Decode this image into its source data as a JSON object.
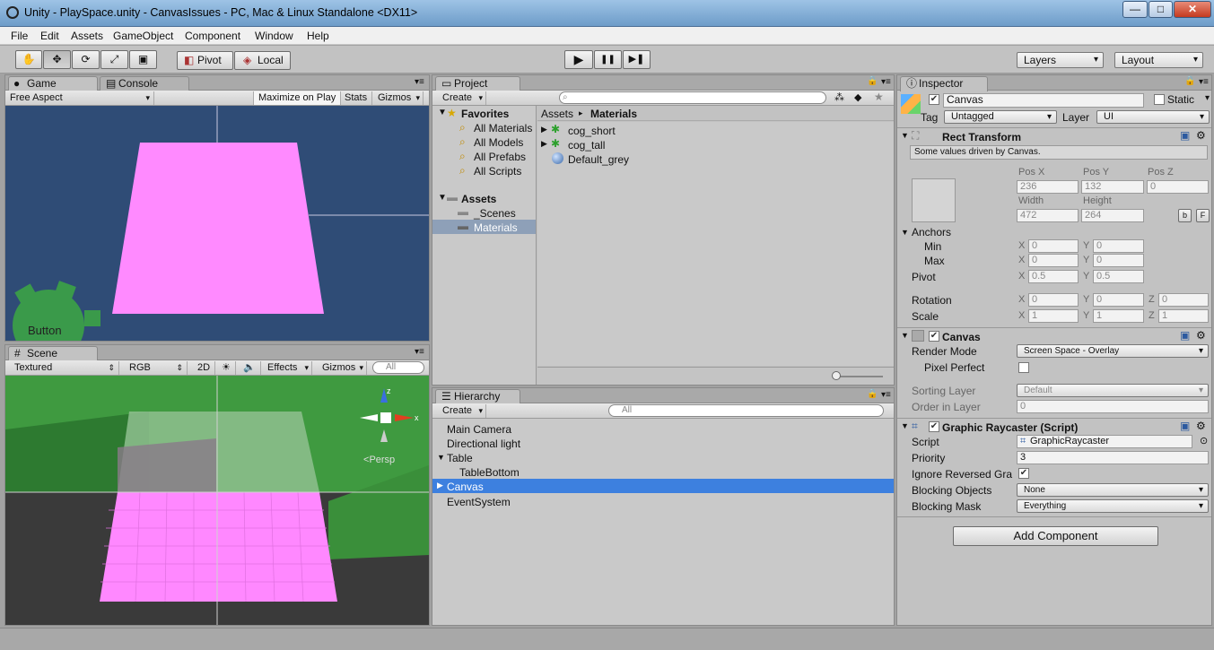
{
  "window": {
    "title": "Unity - PlaySpace.unity - CanvasIssues - PC, Mac & Linux Standalone <DX11>",
    "min": "—",
    "max": "□",
    "close": "✕"
  },
  "menu": [
    "File",
    "Edit",
    "Assets",
    "GameObject",
    "Component",
    "Window",
    "Help"
  ],
  "toolbar": {
    "pivot": "Pivot",
    "local": "Local",
    "play": "▶",
    "pause": "❚❚",
    "step": "▶❚",
    "layers": "Layers",
    "layout": "Layout"
  },
  "game": {
    "tab": "Game",
    "console_tab": "Console",
    "aspect": "Free Aspect",
    "maximize": "Maximize on Play",
    "stats": "Stats",
    "gizmos": "Gizmos",
    "button_label": "Button"
  },
  "scene": {
    "tab": "Scene",
    "shading": "Textured",
    "rgb": "RGB",
    "mode2d": "2D",
    "effects": "Effects",
    "gizmos": "Gizmos",
    "search": "All",
    "persp": "Persp",
    "axis_y": "z",
    "axis_x": "x"
  },
  "project": {
    "tab": "Project",
    "create": "Create",
    "favorites": "Favorites",
    "fav_items": [
      "All Materials",
      "All Models",
      "All Prefabs",
      "All Scripts"
    ],
    "assets": "Assets",
    "asset_items": [
      "_Scenes",
      "Materials"
    ],
    "crumb1": "Assets",
    "crumb_sep": "▸",
    "crumb2": "Materials",
    "files": [
      "cog_short",
      "cog_tall",
      "Default_grey"
    ]
  },
  "hierarchy": {
    "tab": "Hierarchy",
    "create": "Create",
    "search": "All",
    "items": [
      "Main Camera",
      "Directional light",
      "Table",
      "TableBottom",
      "Canvas",
      "EventSystem"
    ]
  },
  "inspector": {
    "tab": "Inspector",
    "name": "Canvas",
    "static": "Static",
    "tag_label": "Tag",
    "tag": "Untagged",
    "layer_label": "Layer",
    "layer": "UI",
    "rect": {
      "title": "Rect Transform",
      "note": "Some values driven by Canvas.",
      "posx_l": "Pos X",
      "posy_l": "Pos Y",
      "posz_l": "Pos Z",
      "posx": "236",
      "posy": "132",
      "posz": "0",
      "w_l": "Width",
      "h_l": "Height",
      "w": "472",
      "h": "264",
      "b": "b",
      "r": "F",
      "anchors": "Anchors",
      "min": "Min",
      "max": "Max",
      "pivot": "Pivot",
      "minx": "0",
      "miny": "0",
      "maxx": "0",
      "maxy": "0",
      "pivx": "0.5",
      "pivy": "0.5",
      "rotation": "Rotation",
      "rotx": "0",
      "roty": "0",
      "rotz": "0",
      "scale": "Scale",
      "sx": "1",
      "sy": "1",
      "sz": "1",
      "X": "X",
      "Y": "Y",
      "Z": "Z"
    },
    "canvas": {
      "title": "Canvas",
      "render_mode_l": "Render Mode",
      "render_mode": "Screen Space - Overlay",
      "pixel_perfect": "Pixel Perfect",
      "sorting_l": "Sorting Layer",
      "sorting": "Default",
      "order_l": "Order in Layer",
      "order": "0"
    },
    "raycaster": {
      "title": "Graphic Raycaster (Script)",
      "script_l": "Script",
      "script": "GraphicRaycaster",
      "priority_l": "Priority",
      "priority": "3",
      "ignore_l": "Ignore Reversed Gra",
      "blocking_l": "Blocking Objects",
      "blocking": "None",
      "mask_l": "Blocking Mask",
      "mask": "Everything"
    },
    "add_component": "Add Component"
  }
}
